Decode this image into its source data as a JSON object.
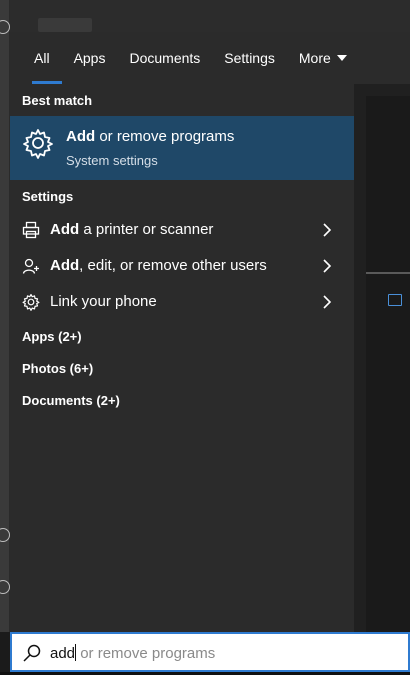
{
  "tabs": [
    {
      "label": "All",
      "active": true
    },
    {
      "label": "Apps"
    },
    {
      "label": "Documents"
    },
    {
      "label": "Settings"
    },
    {
      "label": "More"
    }
  ],
  "best_match": {
    "heading": "Best match",
    "title_bold": "Add",
    "title_rest": " or remove programs",
    "subtitle": "System settings",
    "icon": "gear-icon"
  },
  "settings_section": {
    "heading": "Settings",
    "items": [
      {
        "bold": "Add",
        "rest": " a printer or scanner",
        "icon": "printer-icon"
      },
      {
        "bold": "Add",
        "rest": ", edit, or remove other users",
        "icon": "add-user-icon"
      },
      {
        "bold": "",
        "rest": "Link your phone",
        "icon": "gear-icon"
      }
    ]
  },
  "groups": [
    {
      "label": "Apps (2+)"
    },
    {
      "label": "Photos (6+)"
    },
    {
      "label": "Documents (2+)"
    }
  ],
  "search": {
    "typed": "add",
    "suggestion": " or remove programs",
    "icon": "search-icon"
  },
  "colors": {
    "accent": "#2f7bd0",
    "highlight": "#1f4868",
    "panel": "#2b2b2b"
  }
}
